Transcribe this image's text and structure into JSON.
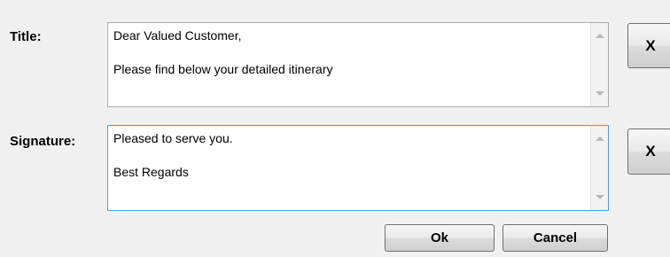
{
  "title_field": {
    "label": "Title:",
    "lines": [
      "Dear Valued Customer,",
      "Please find below your detailed itinerary"
    ],
    "clear_label": "X"
  },
  "signature_field": {
    "label": "Signature:",
    "lines": [
      "Pleased to serve you.",
      "Best Regards"
    ],
    "clear_label": "X"
  },
  "buttons": {
    "ok_label": "Ok",
    "cancel_label": "Cancel"
  }
}
